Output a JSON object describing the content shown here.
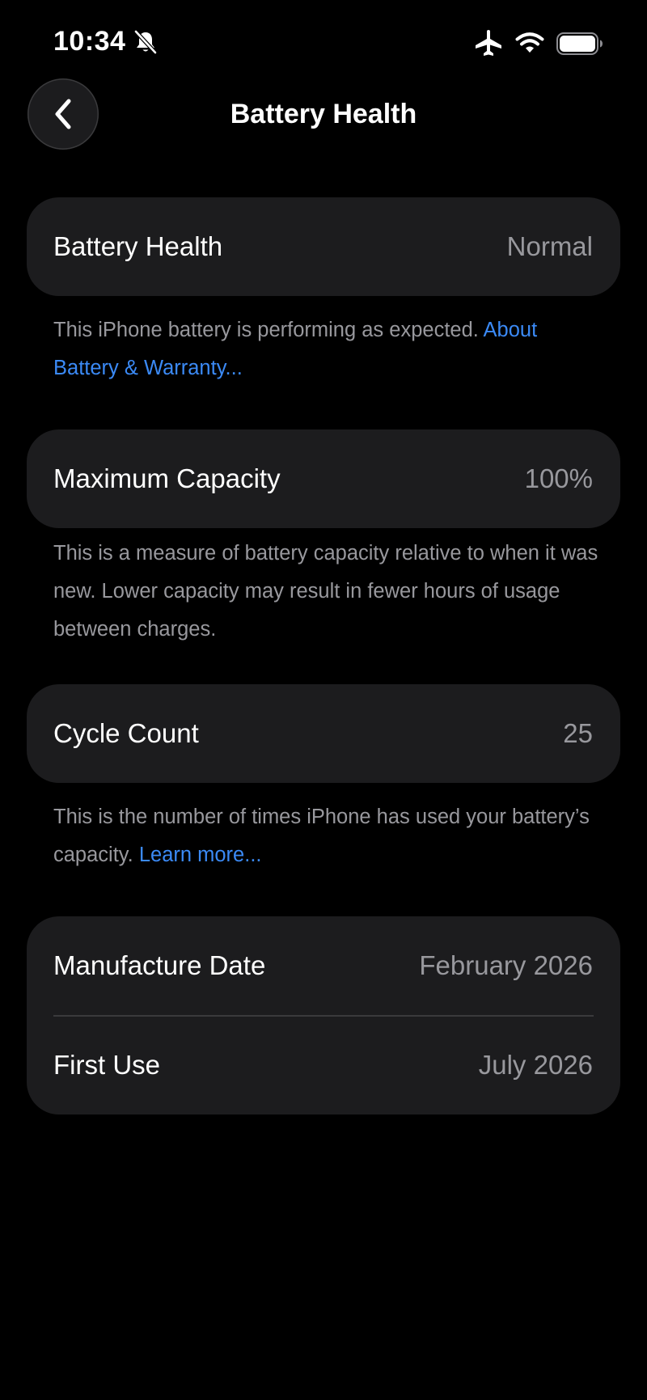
{
  "status_bar": {
    "time": "10:34",
    "icons": [
      "bell-slash-icon",
      "airplane-icon",
      "wifi-icon",
      "battery-icon"
    ]
  },
  "nav": {
    "title": "Battery Health",
    "back_icon": "chevron-left-icon"
  },
  "battery_health": {
    "label": "Battery Health",
    "value": "Normal",
    "footnote_text": "This iPhone battery is performing as expected. ",
    "footnote_link": "About Battery & Warranty..."
  },
  "maximum_capacity": {
    "label": "Maximum Capacity",
    "value": "100%",
    "footnote_text": "This is a measure of battery capacity relative to when it was new. Lower capacity may result in fewer hours of usage between charges."
  },
  "cycle_count": {
    "label": "Cycle Count",
    "value": "25",
    "footnote_text": "This is the number of times iPhone has used your battery’s capacity. ",
    "footnote_link": "Learn more..."
  },
  "dates": {
    "manufacture_label": "Manufacture Date",
    "manufacture_value": "February 2026",
    "first_use_label": "First Use",
    "first_use_value": "July 2026"
  },
  "colors": {
    "background": "#000000",
    "card": "#1c1c1e",
    "secondary_text": "#98989d",
    "link": "#3b8af6"
  }
}
